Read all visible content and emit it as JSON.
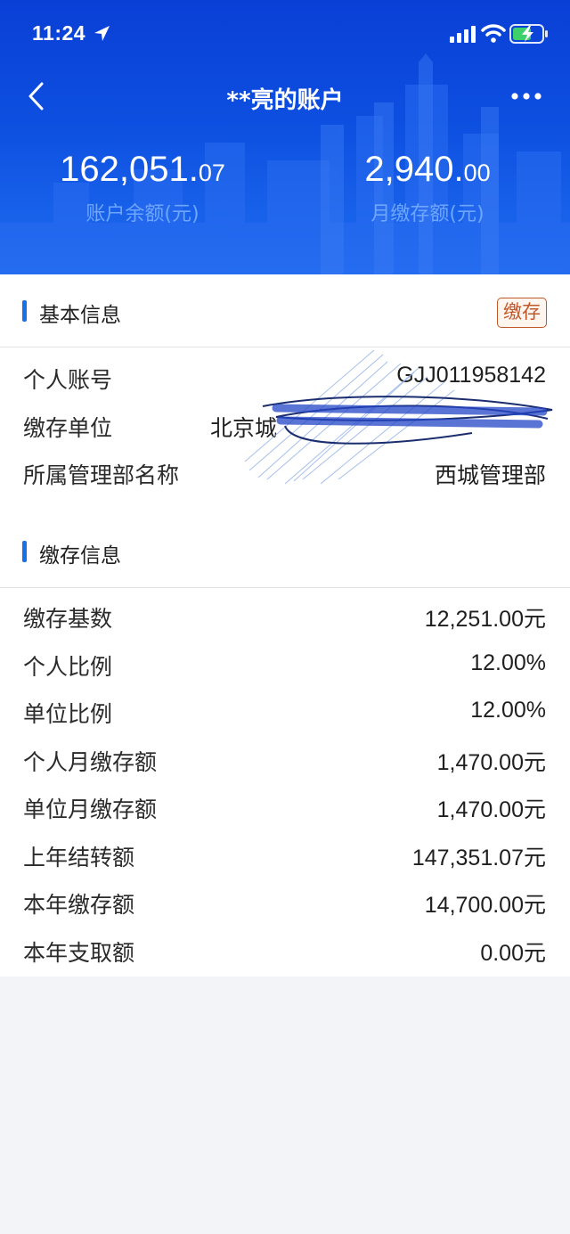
{
  "status_bar": {
    "time": "11:24"
  },
  "nav": {
    "title": "**亮的账户"
  },
  "summary": {
    "balance": {
      "integer": "162,051.",
      "cents": "07",
      "label": "账户余额(元)"
    },
    "monthly": {
      "integer": "2,940.",
      "cents": "00",
      "label": "月缴存额(元)"
    }
  },
  "basic_info": {
    "title": "基本信息",
    "badge": "缴存",
    "rows": [
      {
        "label": "个人账号",
        "value": "GJJ011958142"
      },
      {
        "label": "缴存单位",
        "value": "北京城"
      },
      {
        "label": "所属管理部名称",
        "value": "西城管理部"
      }
    ]
  },
  "deposit_info": {
    "title": "缴存信息",
    "rows": [
      {
        "label": "缴存基数",
        "value": "12,251.00",
        "unit": "元"
      },
      {
        "label": "个人比例",
        "value": "12.00%",
        "unit": ""
      },
      {
        "label": "单位比例",
        "value": "12.00%",
        "unit": ""
      },
      {
        "label": "个人月缴存额",
        "value": "1,470.00",
        "unit": "元"
      },
      {
        "label": "单位月缴存额",
        "value": "1,470.00",
        "unit": "元"
      },
      {
        "label": "上年结转额",
        "value": "147,351.07",
        "unit": "元"
      },
      {
        "label": "本年缴存额",
        "value": "14,700.00",
        "unit": "元"
      },
      {
        "label": "本年支取额",
        "value": "0.00",
        "unit": "元"
      }
    ]
  },
  "colors": {
    "header": "#0d4fe0",
    "accent": "#1672e6",
    "badge": "#c0582a",
    "label_blue": "#6fa6ff"
  },
  "icons": [
    "location-arrow-icon",
    "signal-icon",
    "wifi-icon",
    "battery-charging-icon",
    "chevron-left-icon",
    "more-dots-icon"
  ]
}
